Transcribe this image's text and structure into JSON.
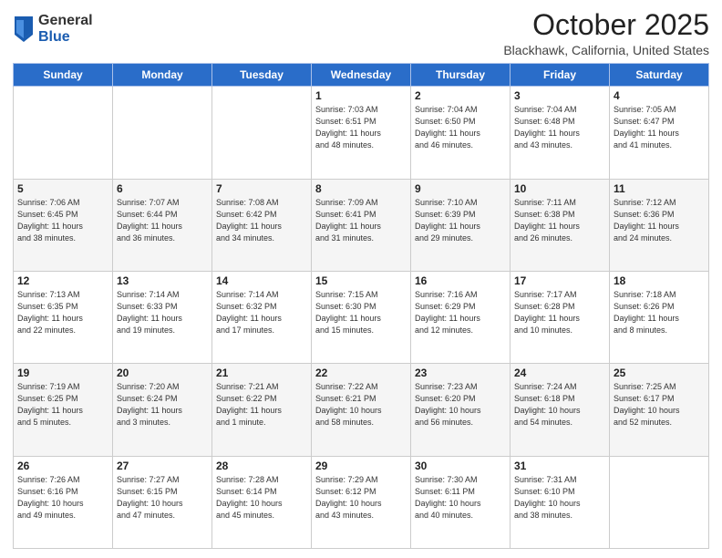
{
  "logo": {
    "general": "General",
    "blue": "Blue"
  },
  "header": {
    "month": "October 2025",
    "location": "Blackhawk, California, United States"
  },
  "weekdays": [
    "Sunday",
    "Monday",
    "Tuesday",
    "Wednesday",
    "Thursday",
    "Friday",
    "Saturday"
  ],
  "weeks": [
    [
      {
        "day": "",
        "info": ""
      },
      {
        "day": "",
        "info": ""
      },
      {
        "day": "",
        "info": ""
      },
      {
        "day": "1",
        "info": "Sunrise: 7:03 AM\nSunset: 6:51 PM\nDaylight: 11 hours\nand 48 minutes."
      },
      {
        "day": "2",
        "info": "Sunrise: 7:04 AM\nSunset: 6:50 PM\nDaylight: 11 hours\nand 46 minutes."
      },
      {
        "day": "3",
        "info": "Sunrise: 7:04 AM\nSunset: 6:48 PM\nDaylight: 11 hours\nand 43 minutes."
      },
      {
        "day": "4",
        "info": "Sunrise: 7:05 AM\nSunset: 6:47 PM\nDaylight: 11 hours\nand 41 minutes."
      }
    ],
    [
      {
        "day": "5",
        "info": "Sunrise: 7:06 AM\nSunset: 6:45 PM\nDaylight: 11 hours\nand 38 minutes."
      },
      {
        "day": "6",
        "info": "Sunrise: 7:07 AM\nSunset: 6:44 PM\nDaylight: 11 hours\nand 36 minutes."
      },
      {
        "day": "7",
        "info": "Sunrise: 7:08 AM\nSunset: 6:42 PM\nDaylight: 11 hours\nand 34 minutes."
      },
      {
        "day": "8",
        "info": "Sunrise: 7:09 AM\nSunset: 6:41 PM\nDaylight: 11 hours\nand 31 minutes."
      },
      {
        "day": "9",
        "info": "Sunrise: 7:10 AM\nSunset: 6:39 PM\nDaylight: 11 hours\nand 29 minutes."
      },
      {
        "day": "10",
        "info": "Sunrise: 7:11 AM\nSunset: 6:38 PM\nDaylight: 11 hours\nand 26 minutes."
      },
      {
        "day": "11",
        "info": "Sunrise: 7:12 AM\nSunset: 6:36 PM\nDaylight: 11 hours\nand 24 minutes."
      }
    ],
    [
      {
        "day": "12",
        "info": "Sunrise: 7:13 AM\nSunset: 6:35 PM\nDaylight: 11 hours\nand 22 minutes."
      },
      {
        "day": "13",
        "info": "Sunrise: 7:14 AM\nSunset: 6:33 PM\nDaylight: 11 hours\nand 19 minutes."
      },
      {
        "day": "14",
        "info": "Sunrise: 7:14 AM\nSunset: 6:32 PM\nDaylight: 11 hours\nand 17 minutes."
      },
      {
        "day": "15",
        "info": "Sunrise: 7:15 AM\nSunset: 6:30 PM\nDaylight: 11 hours\nand 15 minutes."
      },
      {
        "day": "16",
        "info": "Sunrise: 7:16 AM\nSunset: 6:29 PM\nDaylight: 11 hours\nand 12 minutes."
      },
      {
        "day": "17",
        "info": "Sunrise: 7:17 AM\nSunset: 6:28 PM\nDaylight: 11 hours\nand 10 minutes."
      },
      {
        "day": "18",
        "info": "Sunrise: 7:18 AM\nSunset: 6:26 PM\nDaylight: 11 hours\nand 8 minutes."
      }
    ],
    [
      {
        "day": "19",
        "info": "Sunrise: 7:19 AM\nSunset: 6:25 PM\nDaylight: 11 hours\nand 5 minutes."
      },
      {
        "day": "20",
        "info": "Sunrise: 7:20 AM\nSunset: 6:24 PM\nDaylight: 11 hours\nand 3 minutes."
      },
      {
        "day": "21",
        "info": "Sunrise: 7:21 AM\nSunset: 6:22 PM\nDaylight: 11 hours\nand 1 minute."
      },
      {
        "day": "22",
        "info": "Sunrise: 7:22 AM\nSunset: 6:21 PM\nDaylight: 10 hours\nand 58 minutes."
      },
      {
        "day": "23",
        "info": "Sunrise: 7:23 AM\nSunset: 6:20 PM\nDaylight: 10 hours\nand 56 minutes."
      },
      {
        "day": "24",
        "info": "Sunrise: 7:24 AM\nSunset: 6:18 PM\nDaylight: 10 hours\nand 54 minutes."
      },
      {
        "day": "25",
        "info": "Sunrise: 7:25 AM\nSunset: 6:17 PM\nDaylight: 10 hours\nand 52 minutes."
      }
    ],
    [
      {
        "day": "26",
        "info": "Sunrise: 7:26 AM\nSunset: 6:16 PM\nDaylight: 10 hours\nand 49 minutes."
      },
      {
        "day": "27",
        "info": "Sunrise: 7:27 AM\nSunset: 6:15 PM\nDaylight: 10 hours\nand 47 minutes."
      },
      {
        "day": "28",
        "info": "Sunrise: 7:28 AM\nSunset: 6:14 PM\nDaylight: 10 hours\nand 45 minutes."
      },
      {
        "day": "29",
        "info": "Sunrise: 7:29 AM\nSunset: 6:12 PM\nDaylight: 10 hours\nand 43 minutes."
      },
      {
        "day": "30",
        "info": "Sunrise: 7:30 AM\nSunset: 6:11 PM\nDaylight: 10 hours\nand 40 minutes."
      },
      {
        "day": "31",
        "info": "Sunrise: 7:31 AM\nSunset: 6:10 PM\nDaylight: 10 hours\nand 38 minutes."
      },
      {
        "day": "",
        "info": ""
      }
    ]
  ]
}
